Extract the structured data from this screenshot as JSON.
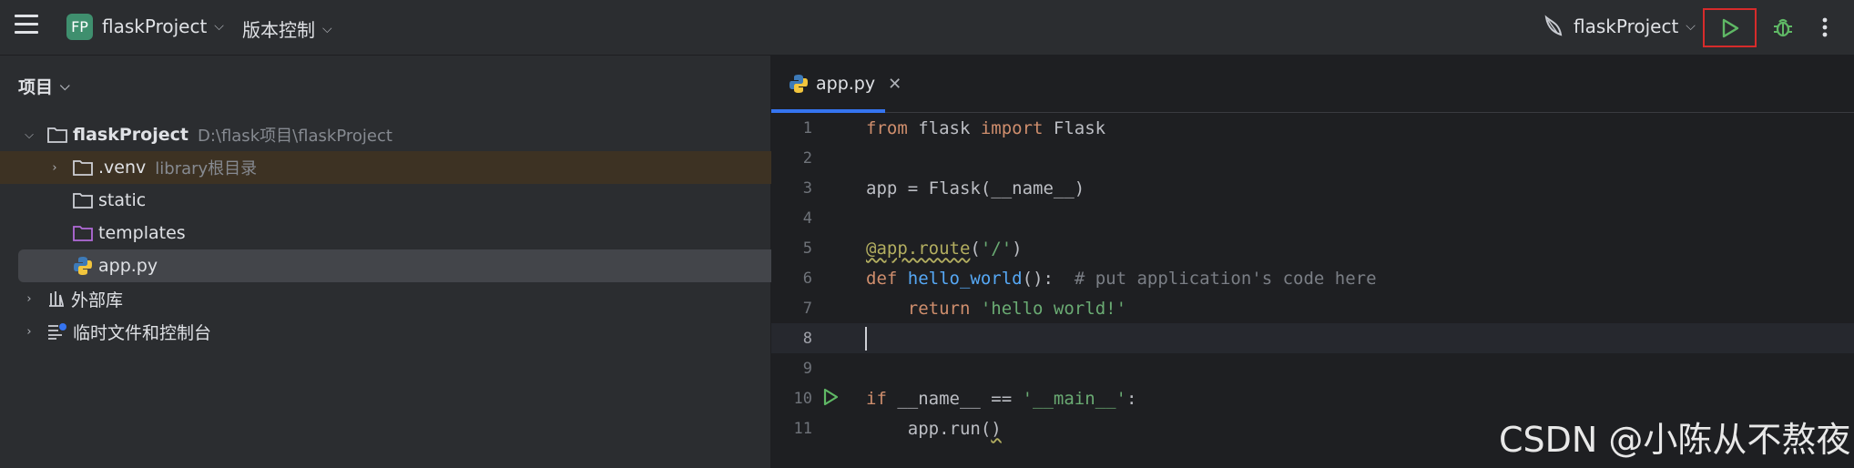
{
  "titlebar": {
    "badge": "FP",
    "project": "flaskProject",
    "vcs": "版本控制",
    "run_config": "flaskProject"
  },
  "project_pane": {
    "title": "项目",
    "tree": [
      {
        "label": "flaskProject",
        "hint": "D:\\flask项目\\flaskProject"
      },
      {
        "label": ".venv",
        "hint": "library根目录"
      },
      {
        "label": "static"
      },
      {
        "label": "templates"
      },
      {
        "label": "app.py"
      },
      {
        "label": "外部库"
      },
      {
        "label": "临时文件和控制台"
      }
    ]
  },
  "editor": {
    "tab": "app.py",
    "line_numbers": [
      "1",
      "2",
      "3",
      "4",
      "5",
      "6",
      "7",
      "8",
      "9",
      "10",
      "11"
    ],
    "code": {
      "l1": {
        "a": "from",
        "b": " flask ",
        "c": "import",
        "d": " Flask"
      },
      "l3": "app = Flask(__name__)",
      "l5": {
        "a": "@app.route",
        "b": "(",
        "c": "'/'",
        "d": ")"
      },
      "l6": {
        "a": "def",
        "b": " ",
        "c": "hello_world",
        "d": "():  ",
        "e": "# put application's code here"
      },
      "l7": {
        "a": "    ",
        "b": "return",
        "c": " ",
        "d": "'hello world!'"
      },
      "l10": {
        "a": "if",
        "b": " __name__ == ",
        "c": "'__main__'",
        "d": ":"
      },
      "l11": {
        "a": "    app.run(",
        "b": ")"
      }
    }
  },
  "watermark": "CSDN @小陈从不熬夜",
  "colors": {
    "accent": "#3574f0",
    "run_green": "#5fb865",
    "highlight_box": "#d62b2b"
  }
}
